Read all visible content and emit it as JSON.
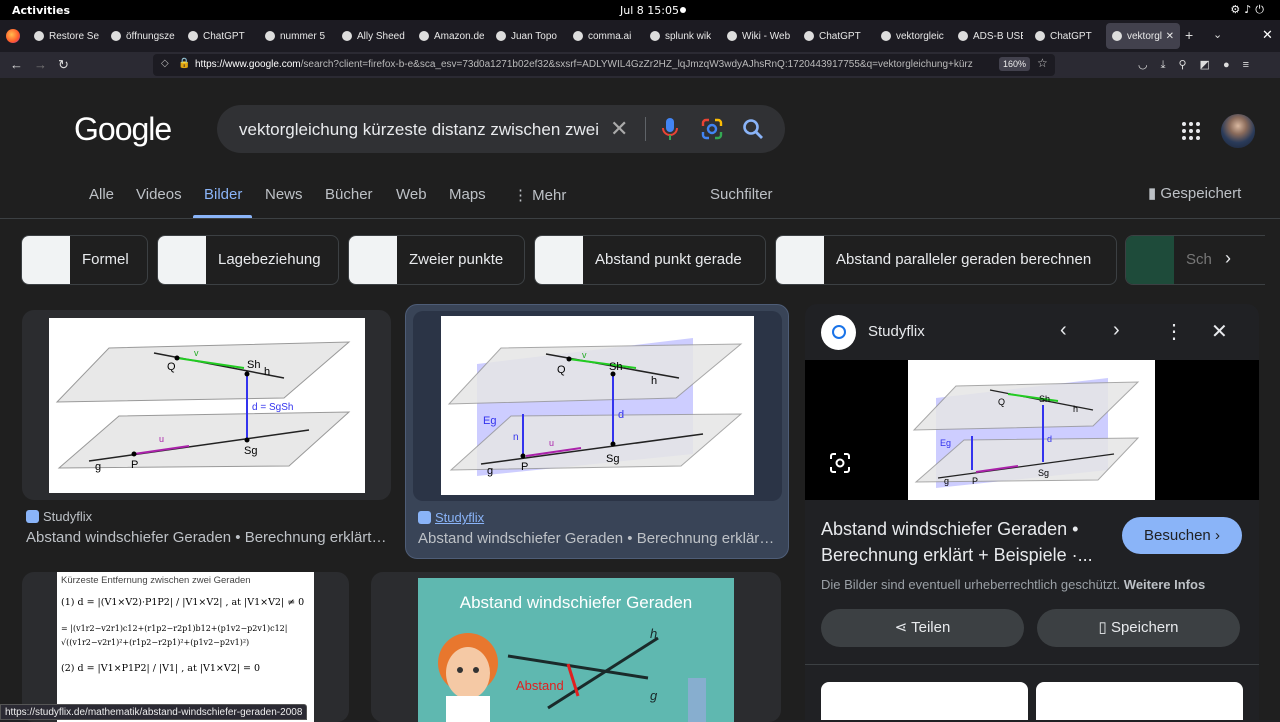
{
  "system": {
    "activities": "Activities",
    "clock": "Jul 8  15:05"
  },
  "tabs": [
    {
      "label": "Restore Se",
      "icon": "info-icon"
    },
    {
      "label": "öffnungsze",
      "icon": "google-icon"
    },
    {
      "label": "ChatGPT",
      "icon": "chatgpt-icon"
    },
    {
      "label": "nummer 5",
      "icon": "google-icon"
    },
    {
      "label": "Ally Sheed",
      "icon": "gif-icon"
    },
    {
      "label": "Amazon.de",
      "icon": "amazon-icon"
    },
    {
      "label": "Juan Topo",
      "icon": "gif-icon"
    },
    {
      "label": "comma.ai",
      "icon": "comma-icon"
    },
    {
      "label": "splunk wik",
      "icon": "google-icon"
    },
    {
      "label": "Wiki - Web",
      "icon": "wiki-icon"
    },
    {
      "label": "ChatGPT",
      "icon": "chatgpt-icon"
    },
    {
      "label": "vektorgleic",
      "icon": "google-icon"
    },
    {
      "label": "ADS-B USE",
      "icon": "adsb-icon"
    },
    {
      "label": "ChatGPT",
      "icon": "chatgpt-icon"
    },
    {
      "label": "vektorgl",
      "icon": "google-icon",
      "active": true
    }
  ],
  "url": {
    "host": "https://www.google.com",
    "rest": "/search?client=firefox-b-e&sca_esv=73d0a1271b02ef32&sxsrf=ADLYWIL4GzZr2HZ_lqJmzqW3wdyAJhsRnQ:1720443917755&q=vektorgleichung+kürz",
    "zoom": "160%"
  },
  "google": {
    "logo": "Google",
    "query": "vektorgleichung kürzeste distanz zwischen zwei"
  },
  "nav": {
    "alle": "Alle",
    "videos": "Videos",
    "bilder": "Bilder",
    "news": "News",
    "buecher": "Bücher",
    "web": "Web",
    "maps": "Maps",
    "mehr": "Mehr",
    "suchfilter": "Suchfilter",
    "gespeichert": "Gespeichert"
  },
  "chips": [
    "Formel",
    "Lagebeziehung",
    "Zweier punkte",
    "Abstand punkt gerade",
    "Abstand paralleler geraden berechnen",
    "Sch"
  ],
  "results": [
    {
      "source": "Studyflix",
      "title": "Abstand windschiefer Geraden • Berechnung erklärt + Beispiele"
    },
    {
      "source": "Studyflix",
      "title": "Abstand windschiefer Geraden • Berechnung erklärt + Beispiele"
    }
  ],
  "thumb_labels": {
    "q": "Q",
    "v": "v",
    "sh": "Sh",
    "h": "h",
    "d": "d",
    "dformula": "d = SgSh",
    "g": "g",
    "p": "P",
    "u": "u",
    "sg": "Sg",
    "eg": "Eg",
    "n": "n"
  },
  "thumb3": {
    "heading": "Kürzeste Entfernung zwischen zwei Geraden",
    "f1": "(1)  d = |(V1×V2)·P1P2| / |V1×V2| ,    at |V1×V2| ≠ 0",
    "f2": "= |(v1r2−v2r1)c12+(r1p2−r2p1)b12+(p1v2−p2v1)c12|",
    "f3": "√((v1r2−v2r1)²+(r1p2−r2p1)²+(p1v2−p2v1)²)",
    "f4": "(2)  d = |V1×P1P2| / |V1| ,    at |V1×V2| = 0"
  },
  "thumb4": {
    "title": "Abstand windschiefer Geraden",
    "label": "Abstand",
    "h": "h",
    "g": "g"
  },
  "panel": {
    "source": "Studyflix",
    "title": "Abstand windschiefer Geraden • Berechnung erklärt + Beispiele ·...",
    "visit": "Besuchen",
    "copyright": "Die Bilder sind eventuell urheberrechtlich geschützt.",
    "more": "Weitere Infos",
    "share": "Teilen",
    "save": "Speichern"
  },
  "status": {
    "link": "https://studyflix.de/mathematik/abstand-windschiefer-geraden-2008"
  }
}
